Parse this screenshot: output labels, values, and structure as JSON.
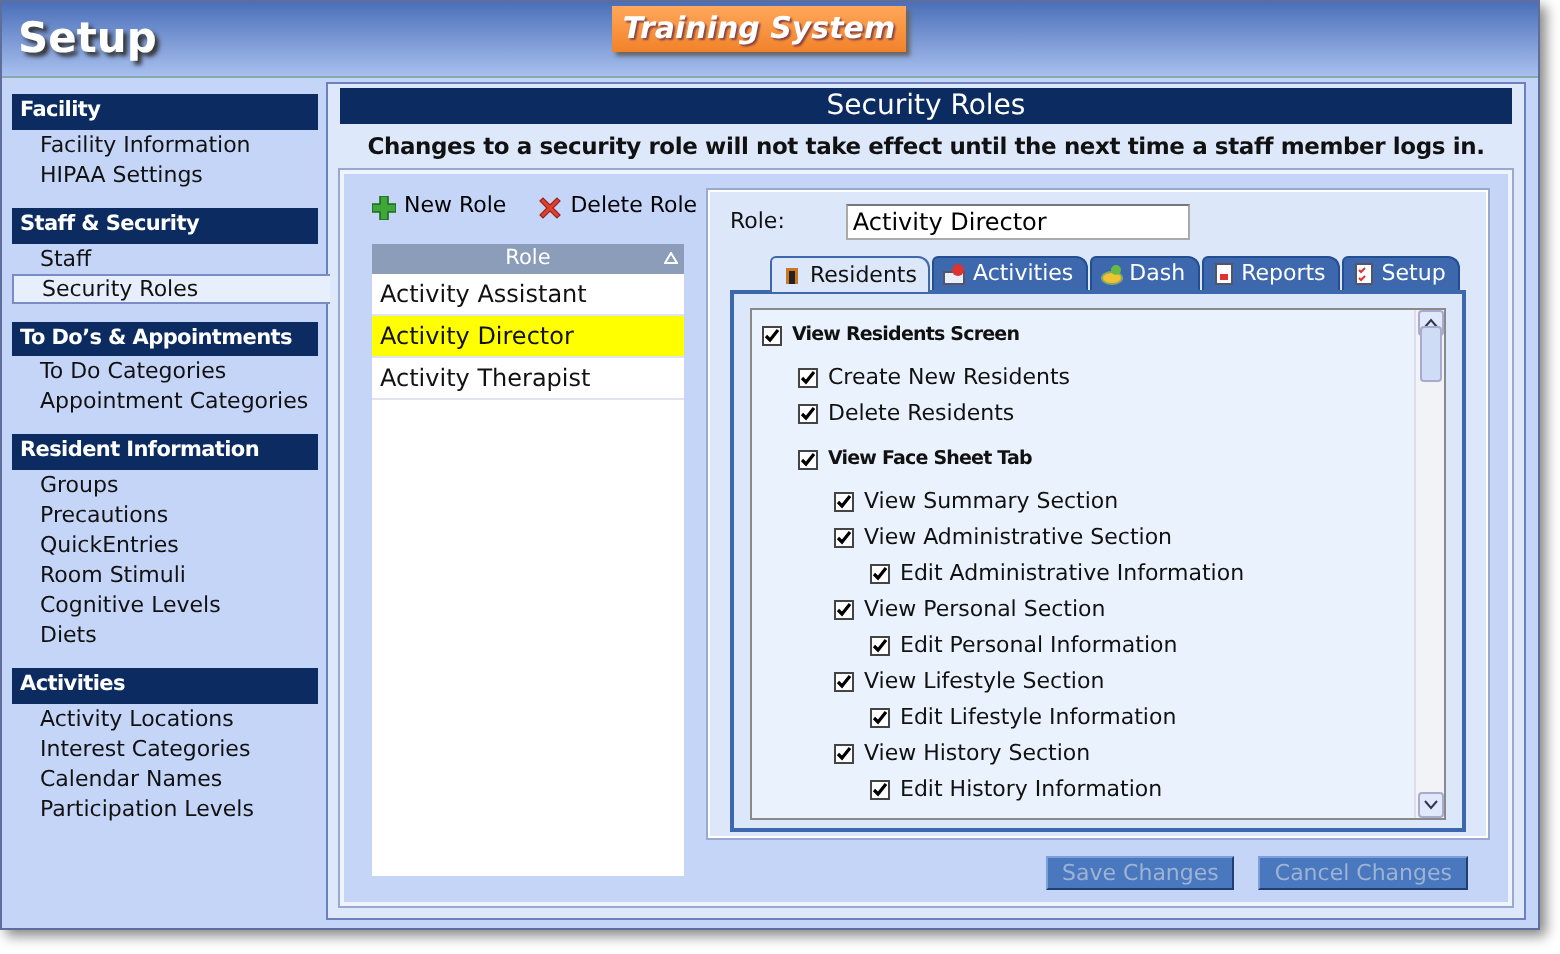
{
  "header": {
    "title": "Setup",
    "badge": "Training System"
  },
  "sidebar": [
    {
      "heading": "Facility",
      "items": [
        {
          "label": "Facility Information",
          "selected": false
        },
        {
          "label": "HIPAA Settings",
          "selected": false
        }
      ]
    },
    {
      "heading": "Staff & Security",
      "items": [
        {
          "label": "Staff",
          "selected": false
        },
        {
          "label": "Security Roles",
          "selected": true
        }
      ]
    },
    {
      "heading": "To Do’s & Appointments",
      "items": [
        {
          "label": "To Do Categories",
          "selected": false
        },
        {
          "label": "Appointment Categories",
          "selected": false
        }
      ]
    },
    {
      "heading": "Resident Information",
      "items": [
        {
          "label": "Groups",
          "selected": false
        },
        {
          "label": "Precautions",
          "selected": false
        },
        {
          "label": "QuickEntries",
          "selected": false
        },
        {
          "label": "Room Stimuli",
          "selected": false
        },
        {
          "label": "Cognitive Levels",
          "selected": false
        },
        {
          "label": "Diets",
          "selected": false
        }
      ]
    },
    {
      "heading": "Activities",
      "items": [
        {
          "label": "Activity Locations",
          "selected": false
        },
        {
          "label": "Interest Categories",
          "selected": false
        },
        {
          "label": "Calendar Names",
          "selected": false
        },
        {
          "label": "Participation Levels",
          "selected": false
        }
      ]
    }
  ],
  "main": {
    "title": "Security Roles",
    "notice": "Changes to a security role will not take effect until the next time a staff member logs in.",
    "toolbar": [
      {
        "kind": "add",
        "label": "New Role"
      },
      {
        "kind": "delete",
        "label": "Delete Role"
      }
    ],
    "roles_table": {
      "column": "Role",
      "rows": [
        {
          "name": "Activity Assistant",
          "selected": false
        },
        {
          "name": "Activity Director",
          "selected": true
        },
        {
          "name": "Activity Therapist",
          "selected": false
        }
      ]
    },
    "role_field": {
      "label": "Role:",
      "value": "Activity Director"
    },
    "tabs": [
      {
        "kind": "residents",
        "label": "Residents",
        "selected": true
      },
      {
        "kind": "activities",
        "label": "Activities",
        "selected": false
      },
      {
        "kind": "dash",
        "label": "Dash",
        "selected": false
      },
      {
        "kind": "reports",
        "label": "Reports",
        "selected": false
      },
      {
        "kind": "setup",
        "label": "Setup",
        "selected": false
      }
    ],
    "permissions": [
      {
        "kind": "heading",
        "label": "View Residents Screen",
        "checked": true,
        "children": [
          {
            "kind": "item",
            "label": "Create New Residents",
            "checked": true
          },
          {
            "kind": "item",
            "label": "Delete Residents",
            "checked": true
          },
          {
            "kind": "heading",
            "label": "View Face Sheet Tab",
            "checked": true,
            "children": [
              {
                "kind": "item",
                "label": "View Summary Section",
                "checked": true
              },
              {
                "kind": "item",
                "label": "View Administrative Section",
                "checked": true,
                "children": [
                  {
                    "kind": "item",
                    "label": "Edit Administrative Information",
                    "checked": true
                  }
                ]
              },
              {
                "kind": "item",
                "label": "View Personal Section",
                "checked": true,
                "children": [
                  {
                    "kind": "item",
                    "label": "Edit Personal Information",
                    "checked": true
                  }
                ]
              },
              {
                "kind": "item",
                "label": "View Lifestyle Section",
                "checked": true,
                "children": [
                  {
                    "kind": "item",
                    "label": "Edit Lifestyle Information",
                    "checked": true
                  }
                ]
              },
              {
                "kind": "item",
                "label": "View History Section",
                "checked": true,
                "children": [
                  {
                    "kind": "item",
                    "label": "Edit History Information",
                    "checked": true
                  }
                ]
              }
            ]
          }
        ]
      }
    ],
    "buttons": [
      {
        "label": "Save Changes",
        "disabled": true
      },
      {
        "label": "Cancel Changes",
        "disabled": true
      }
    ]
  }
}
